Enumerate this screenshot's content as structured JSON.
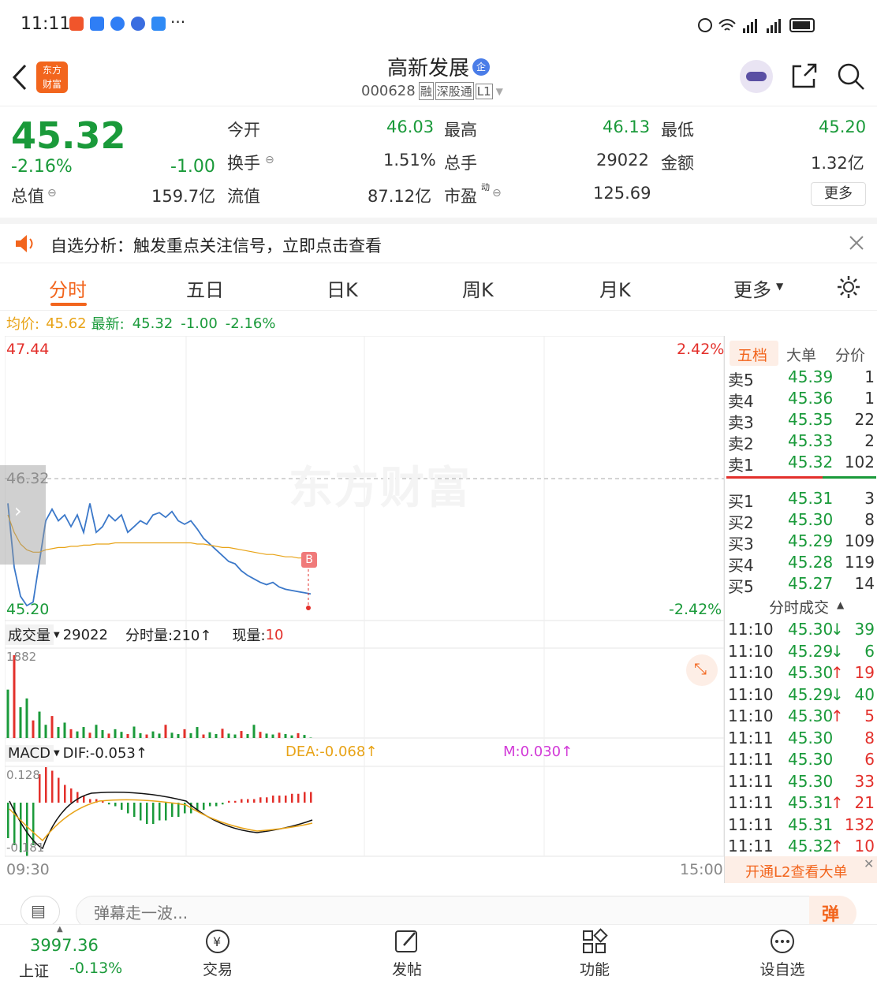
{
  "status": {
    "time": "11:11",
    "dots": "···"
  },
  "header": {
    "title": "高新发展",
    "title_badge": "企",
    "code": "000628",
    "tags": [
      "融",
      "深股通",
      "L1"
    ],
    "logo_text": "东方\n财富"
  },
  "quote": {
    "price": "45.32",
    "change_pct": "-2.16%",
    "change": "-1.00",
    "open_label": "今开",
    "open": "46.03",
    "high_label": "最高",
    "high": "46.13",
    "low_label": "最低",
    "low": "45.20",
    "turnover_label": "换手",
    "turnover": "1.51%",
    "volume_label": "总手",
    "volume": "29022",
    "amount_label": "金额",
    "amount": "1.32亿",
    "mktcap_label": "总值",
    "mktcap": "159.7亿",
    "float_label": "流值",
    "float_cap": "87.12亿",
    "pe_label": "市盈",
    "pe_sup": "动",
    "pe": "125.69",
    "more_label": "更多"
  },
  "notice": {
    "text": "自选分析：触发重点关注信号，立即点击查看"
  },
  "tabs": [
    "分时",
    "五日",
    "日K",
    "周K",
    "月K",
    "更多"
  ],
  "avg_line": {
    "avg_label": "均价:",
    "avg": "45.62",
    "latest_label": "最新:",
    "latest": "45.32",
    "chg": "-1.00",
    "chg_pct": "-2.16%"
  },
  "chart": {
    "y_top": "47.44",
    "y_mid": "46.32",
    "y_bot": "45.20",
    "pct_top": "2.42%",
    "pct_bot": "-2.42%",
    "watermark": "东方财富",
    "b_marker": "B",
    "time_start": "09:30",
    "time_end": "15:00"
  },
  "volume_bar": {
    "label": "成交量",
    "total": "29022",
    "min_label": "分时量:210↑",
    "now_label": "现量:",
    "now": "10",
    "max_tick": "1882"
  },
  "macd": {
    "label": "MACD",
    "dif": "DIF:-0.053↑",
    "dea": "DEA:-0.068↑",
    "m": "M:0.030↑",
    "top_tick": "0.128",
    "bot_tick": "-0.181"
  },
  "chart_data": {
    "type": "line",
    "title": "",
    "ylim": [
      45.2,
      47.44
    ],
    "series": [
      {
        "name": "最新",
        "values": [
          46.1,
          45.55,
          45.3,
          45.22,
          45.25,
          45.6,
          45.95,
          46.05,
          45.95,
          46.0,
          45.9,
          46.0,
          45.85,
          46.1,
          45.85,
          45.9,
          46.0,
          45.95,
          46.0,
          45.85,
          45.9,
          45.95,
          45.92,
          46.0,
          46.02,
          45.98,
          46.03,
          45.95,
          45.92,
          45.95,
          45.88,
          45.8,
          45.75,
          45.7,
          45.65,
          45.6,
          45.58,
          45.52,
          45.48,
          45.45,
          45.42,
          45.4,
          45.42,
          45.38,
          45.36,
          45.35,
          45.34,
          45.33,
          45.32
        ]
      },
      {
        "name": "均价",
        "values": [
          46.0,
          45.85,
          45.75,
          45.7,
          45.68,
          45.68,
          45.7,
          45.71,
          45.72,
          45.72,
          45.73,
          45.73,
          45.74,
          45.74,
          45.75,
          45.75,
          45.75,
          45.76,
          45.76,
          45.76,
          45.76,
          45.76,
          45.76,
          45.76,
          45.76,
          45.76,
          45.76,
          45.76,
          45.76,
          45.76,
          45.75,
          45.75,
          45.74,
          45.73,
          45.72,
          45.72,
          45.71,
          45.7,
          45.69,
          45.68,
          45.67,
          45.66,
          45.66,
          45.65,
          45.64,
          45.64,
          45.63,
          45.63,
          45.62
        ]
      }
    ],
    "volume": [
      1100,
      1882,
      700,
      900,
      400,
      600,
      300,
      500,
      250,
      350,
      200,
      150,
      250,
      120,
      300,
      180,
      100,
      200,
      140,
      90,
      260,
      110,
      80,
      150,
      100,
      300,
      120,
      90,
      200,
      110,
      250,
      80,
      130,
      90,
      210,
      100,
      80,
      160,
      90,
      300,
      140,
      100,
      80,
      120,
      90,
      60,
      110,
      70,
      10
    ],
    "macd_hist": [
      -0.1,
      -0.12,
      -0.14,
      -0.15,
      -0.12,
      0.08,
      0.1,
      0.09,
      0.07,
      0.05,
      0.04,
      0.03,
      0.02,
      0.01,
      0.01,
      0.005,
      -0.005,
      -0.01,
      -0.02,
      -0.03,
      -0.04,
      -0.05,
      -0.06,
      -0.06,
      -0.05,
      -0.05,
      -0.04,
      -0.04,
      -0.03,
      -0.03,
      -0.02,
      -0.02,
      -0.01,
      -0.01,
      -0.005,
      0.005,
      0.005,
      0.01,
      0.01,
      0.01,
      0.015,
      0.015,
      0.02,
      0.02,
      0.02,
      0.025,
      0.025,
      0.03,
      0.03
    ]
  },
  "orderbook": {
    "tabs": [
      "五档",
      "大单",
      "分价"
    ],
    "asks": [
      {
        "label": "卖5",
        "price": "45.39",
        "vol": "1"
      },
      {
        "label": "卖4",
        "price": "45.36",
        "vol": "1"
      },
      {
        "label": "卖3",
        "price": "45.35",
        "vol": "22"
      },
      {
        "label": "卖2",
        "price": "45.33",
        "vol": "2"
      },
      {
        "label": "卖1",
        "price": "45.32",
        "vol": "102"
      }
    ],
    "bids": [
      {
        "label": "买1",
        "price": "45.31",
        "vol": "3"
      },
      {
        "label": "买2",
        "price": "45.30",
        "vol": "8"
      },
      {
        "label": "买3",
        "price": "45.29",
        "vol": "109"
      },
      {
        "label": "买4",
        "price": "45.28",
        "vol": "119"
      },
      {
        "label": "买5",
        "price": "45.27",
        "vol": "14"
      }
    ],
    "ticks_title": "分时成交",
    "ticks": [
      {
        "time": "11:10",
        "price": "45.30",
        "dir": "↓",
        "vol": "39",
        "c": "g"
      },
      {
        "time": "11:10",
        "price": "45.29",
        "dir": "↓",
        "vol": "6",
        "c": "g"
      },
      {
        "time": "11:10",
        "price": "45.30",
        "dir": "↑",
        "vol": "19",
        "c": "r"
      },
      {
        "time": "11:10",
        "price": "45.29",
        "dir": "↓",
        "vol": "40",
        "c": "g"
      },
      {
        "time": "11:10",
        "price": "45.30",
        "dir": "↑",
        "vol": "5",
        "c": "r"
      },
      {
        "time": "11:11",
        "price": "45.30",
        "dir": "",
        "vol": "8",
        "c": "r"
      },
      {
        "time": "11:11",
        "price": "45.30",
        "dir": "",
        "vol": "6",
        "c": "r"
      },
      {
        "time": "11:11",
        "price": "45.30",
        "dir": "",
        "vol": "33",
        "c": "r"
      },
      {
        "time": "11:11",
        "price": "45.31",
        "dir": "↑",
        "vol": "21",
        "c": "r"
      },
      {
        "time": "11:11",
        "price": "45.31",
        "dir": "",
        "vol": "132",
        "c": "r"
      },
      {
        "time": "11:11",
        "price": "45.32",
        "dir": "↑",
        "vol": "10",
        "c": "r"
      }
    ],
    "l2_label": "开通L2查看大单"
  },
  "danmu": {
    "placeholder": "弹幕走一波...",
    "btn": "弹"
  },
  "bottom": {
    "index_value": "3997.36",
    "index_name": "上证",
    "index_chg": "-0.13%",
    "items": [
      "交易",
      "发帖",
      "功能",
      "设自选"
    ]
  },
  "colors": {
    "up": "#e3302b",
    "down": "#1a9a3a",
    "accent": "#f2651d",
    "avg": "#e8a317",
    "price_line": "#3b78c9"
  }
}
